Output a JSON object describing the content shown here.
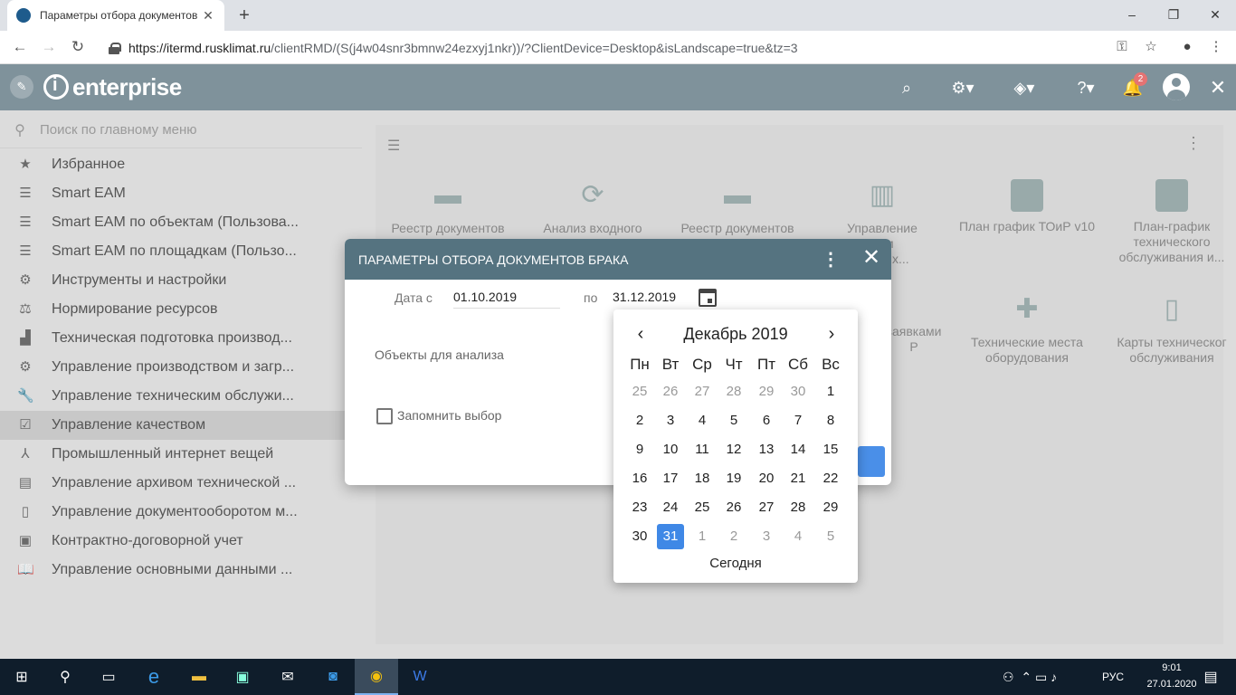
{
  "browser": {
    "tab_title": "Параметры отбора документов",
    "tab_close": "✕",
    "new_tab": "+",
    "url_host": "https://itermd.rusklimat.ru",
    "url_path": "/clientRMD/(S(j4w04snr3bmnw24ezxyj1nkr))/?ClientDevice=Desktop&isLandscape=true&tz=3",
    "window_controls": [
      "–",
      "❐",
      "✕"
    ]
  },
  "app": {
    "logo_text": "enterprise",
    "notification_count": "2"
  },
  "sidebar": {
    "search_placeholder": "Поиск по главному меню",
    "items": [
      {
        "label": "Избранное",
        "icon": "star-icon"
      },
      {
        "label": "Smart EAM",
        "icon": "list-icon"
      },
      {
        "label": "Smart EAM по объектам (Пользова...",
        "icon": "list-icon"
      },
      {
        "label": "Smart EAM по площадкам (Пользо...",
        "icon": "list-icon"
      },
      {
        "label": "Инструменты и настройки",
        "icon": "settings-box-icon"
      },
      {
        "label": "Нормирование ресурсов",
        "icon": "scale-icon"
      },
      {
        "label": "Техническая подготовка производ...",
        "icon": "factory-icon"
      },
      {
        "label": "Управление производством и загр...",
        "icon": "gear-icon"
      },
      {
        "label": "Управление техническим обслужи...",
        "icon": "wrench-icon"
      },
      {
        "label": "Управление качеством",
        "icon": "checkbox-icon"
      },
      {
        "label": "Промышленный интернет вещей",
        "icon": "network-icon"
      },
      {
        "label": "Управление архивом технической ...",
        "icon": "archive-icon"
      },
      {
        "label": "Управление документооборотом м...",
        "icon": "document-icon"
      },
      {
        "label": "Контрактно-договорной учет",
        "icon": "contract-icon"
      },
      {
        "label": "Управление основными данными ...",
        "icon": "book-icon"
      }
    ]
  },
  "tiles": [
    {
      "label": "Реестр документов",
      "icon": "folder-icon"
    },
    {
      "label": "Анализ входного",
      "icon": "search-refresh-icon"
    },
    {
      "label": "Реестр документов",
      "icon": "folder-icon"
    },
    {
      "label": "Управление\nием\nвенных...",
      "icon": "chart-comment-icon"
    },
    {
      "label": "План график ТОиР v10",
      "icon": "bar-chart-icon"
    },
    {
      "label": "План-график\nтехнического\nобслуживания и...",
      "icon": "bar-chart-icon"
    },
    {
      "label": "заявками\nР",
      "icon": "tool-icon"
    },
    {
      "label": "Технические места\nоборудования",
      "icon": "puzzle-icon"
    },
    {
      "label": "Карты техническог\nобслуживания",
      "icon": "document-icon"
    }
  ],
  "modal": {
    "title": "ПАРАМЕТРЫ ОТБОРА ДОКУМЕНТОВ БРАКА",
    "date_from_label": "Дата с",
    "date_from": "01.10.2019",
    "date_to_label": "по",
    "date_to": "31.12.2019",
    "objects_label": "Объекты для анализа",
    "remember_label": "Запомнить выбор"
  },
  "calendar": {
    "prev": "‹",
    "next": "›",
    "month_title": "Декабрь 2019",
    "weekdays": [
      "Пн",
      "Вт",
      "Ср",
      "Чт",
      "Пт",
      "Сб",
      "Вс"
    ],
    "weeks": [
      [
        "25",
        "26",
        "27",
        "28",
        "29",
        "30",
        "1"
      ],
      [
        "2",
        "3",
        "4",
        "5",
        "6",
        "7",
        "8"
      ],
      [
        "9",
        "10",
        "11",
        "12",
        "13",
        "14",
        "15"
      ],
      [
        "16",
        "17",
        "18",
        "19",
        "20",
        "21",
        "22"
      ],
      [
        "23",
        "24",
        "25",
        "26",
        "27",
        "28",
        "29"
      ],
      [
        "30",
        "31",
        "1",
        "2",
        "3",
        "4",
        "5"
      ]
    ],
    "selected_day": "31",
    "today_label": "Сегодня"
  },
  "taskbar": {
    "lang": "РУС",
    "time": "9:01",
    "date": "27.01.2020"
  }
}
